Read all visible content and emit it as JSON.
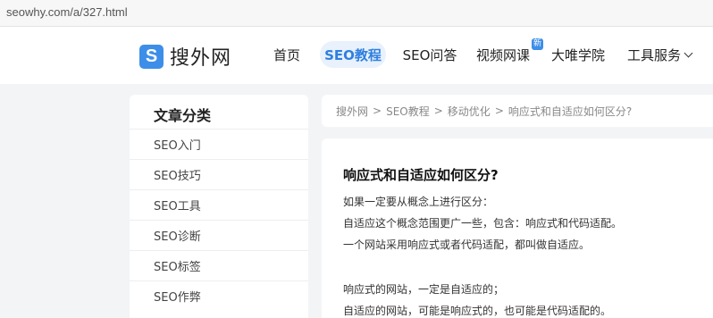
{
  "browser": {
    "url": "seowhy.com/a/327.html"
  },
  "header": {
    "logo_letter": "S",
    "logo_text": "搜外网",
    "nav": {
      "home": "首页",
      "seo_tutorial": "SEO教程",
      "seo_qa": "SEO问答",
      "video": "视频网课",
      "video_badge": "新",
      "academy": "大唯学院",
      "tools": "工具服务"
    }
  },
  "sidebar": {
    "title": "文章分类",
    "items": [
      "SEO入门",
      "SEO技巧",
      "SEO工具",
      "SEO诊断",
      "SEO标签",
      "SEO作弊"
    ]
  },
  "breadcrumb": [
    "搜外网",
    "SEO教程",
    "移动优化",
    "响应式和自适应如何区分?"
  ],
  "breadcrumb_sep": ">",
  "article": {
    "title": "响应式和自适应如何区分?",
    "paragraphs": [
      "如果一定要从概念上进行区分：",
      "自适应这个概念范围更广一些，包含：响应式和代码适配。",
      "一个网站采用响应式或者代码适配，都叫做自适应。",
      "响应式的网站，一定是自适应的；",
      "自适应的网站，可能是响应式的，也可能是代码适配的。"
    ]
  }
}
